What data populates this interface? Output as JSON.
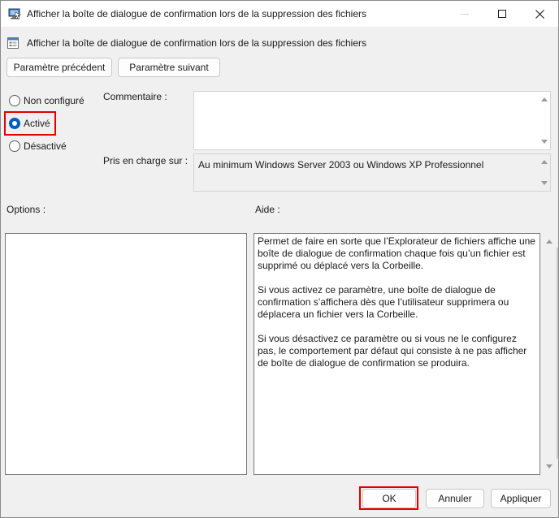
{
  "window": {
    "title": "Afficher la boîte de dialogue de confirmation lors de la suppression des fichiers"
  },
  "header": {
    "heading": "Afficher la boîte de dialogue de confirmation lors de la suppression des fichiers",
    "prev_label": "Paramètre précédent",
    "next_label": "Paramètre suivant"
  },
  "state": {
    "options": [
      {
        "label": "Non configuré",
        "checked": false
      },
      {
        "label": "Activé",
        "checked": true
      },
      {
        "label": "Désactivé",
        "checked": false
      }
    ]
  },
  "comment": {
    "label": "Commentaire :",
    "value": ""
  },
  "support": {
    "label": "Pris en charge sur :",
    "value": "Au minimum Windows Server 2003 ou Windows XP Professionnel"
  },
  "options_panel": {
    "label": "Options :"
  },
  "help_panel": {
    "label": "Aide :",
    "paragraphs": [
      "Permet de faire en sorte que l’Explorateur de fichiers affiche une boîte de dialogue de confirmation chaque fois qu’un fichier est supprimé ou déplacé vers la Corbeille.",
      "Si vous activez ce paramètre, une boîte de dialogue de confirmation s’affichera dès que l’utilisateur supprimera ou déplacera un fichier vers la Corbeille.",
      "Si vous désactivez ce paramètre ou si vous ne le configurez pas, le comportement par défaut qui consiste à ne pas afficher de boîte de dialogue de confirmation se produira."
    ]
  },
  "footer": {
    "ok_label": "OK",
    "cancel_label": "Annuler",
    "apply_label": "Appliquer"
  },
  "colors": {
    "accent": "#005fb8",
    "highlight": "#e10000"
  }
}
